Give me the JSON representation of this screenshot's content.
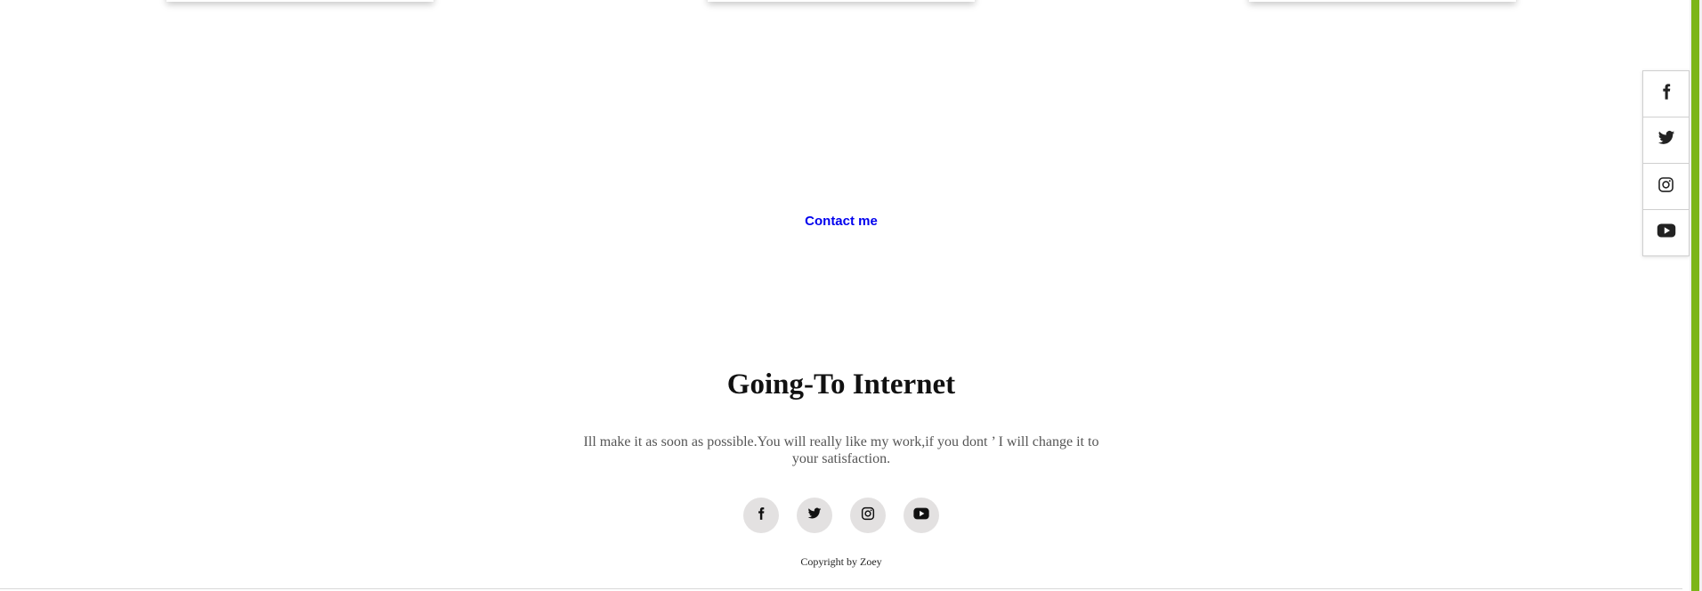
{
  "cards": [
    {
      "name": "card-1"
    },
    {
      "name": "card-2"
    },
    {
      "name": "card-3"
    }
  ],
  "contact": {
    "label": "Contact me"
  },
  "footer": {
    "title": "Going-To Internet",
    "text": "Ill make it as soon as possible.You will really like my work,if you dont ’ I will change it to your satisfaction.",
    "copyright": "Copyright by Zoey",
    "social_icons": [
      "facebook-icon",
      "twitter-icon",
      "instagram-icon",
      "youtube-icon"
    ]
  },
  "side_social_icons": [
    "facebook-icon",
    "twitter-icon",
    "instagram-icon",
    "youtube-icon"
  ],
  "colors": {
    "link": "#0000ee",
    "title": "#111111",
    "body_text": "#555555",
    "icon_circle_bg": "#e3e1e1",
    "scroll_thumb": "#7cb518"
  }
}
